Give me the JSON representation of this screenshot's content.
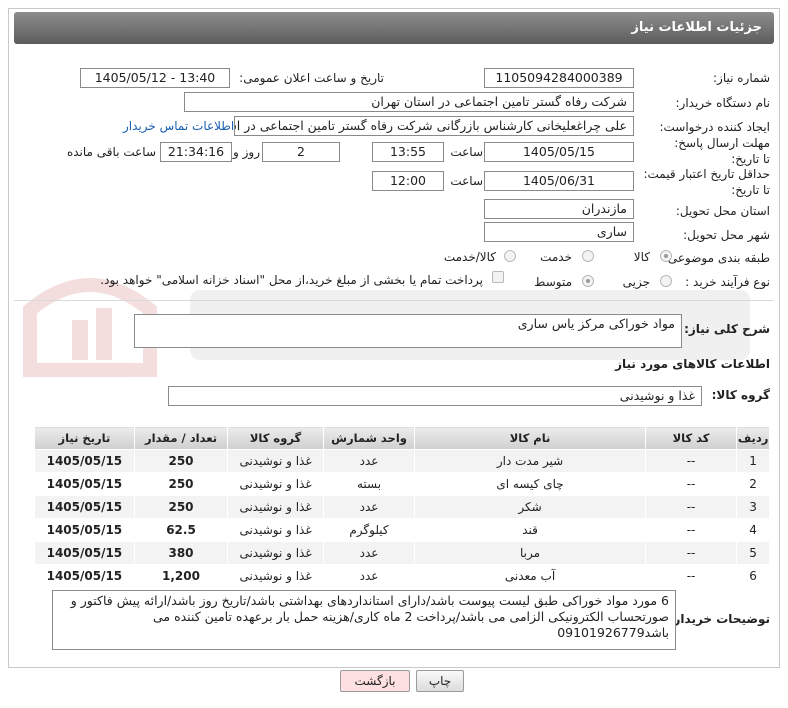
{
  "header": {
    "title": "جزئیات اطلاعات نیاز"
  },
  "fields": {
    "need_number_label": "شماره نیاز:",
    "need_number": "1105094284000389",
    "announce_label": "تاریخ و ساعت اعلان عمومی:",
    "announce_value": "1405/05/12 - 13:40",
    "buyer_org_label": "نام دستگاه خریدار:",
    "buyer_org": "شرکت رفاه گستر تامین اجتماعی در استان تهران",
    "creator_label": "ایجاد کننده درخواست:",
    "creator": "علی چراغعلیخانی کارشناس بازرگانی شرکت رفاه گستر تامین اجتماعی در استا",
    "contact_link": "اطلاعات تماس خریدار",
    "deadline_label": "مهلت ارسال پاسخ: تا تاریخ:",
    "deadline_date": "1405/05/15",
    "time_label": "ساعت",
    "deadline_time": "13:55",
    "days_value": "2",
    "days_label": "روز و",
    "remaining_time": "21:34:16",
    "remaining_label": "ساعت باقی مانده",
    "price_validity_label": "حداقل تاریخ اعتبار قیمت: تا تاریخ:",
    "price_validity_date": "1405/06/31",
    "price_validity_time": "12:00",
    "province_label": "استان محل تحویل:",
    "province": "مازندران",
    "city_label": "شهر محل تحویل:",
    "city": "ساری",
    "category_label": "طبقه بندی موضوعی:",
    "category_options": [
      "کالا",
      "خدمت",
      "کالا/خدمت"
    ],
    "purchase_type_label": "نوع فرآیند خرید :",
    "purchase_options": [
      "جزیی",
      "متوسط"
    ],
    "payment_note": "پرداخت تمام یا بخشی از مبلغ خرید،از محل \"اسناد خزانه اسلامی\" خواهد بود."
  },
  "description": {
    "label": "شرح کلی نیاز:",
    "value": "مواد خوراکی مرکز یاس ساری"
  },
  "goods_section": {
    "title": "اطلاعات کالاهای مورد نیاز",
    "group_label": "گروه کالا:",
    "group_value": "غذا و نوشیدنی"
  },
  "table": {
    "headers": [
      "ردیف",
      "کد کالا",
      "نام کالا",
      "واحد شمارش",
      "گروه کالا",
      "تعداد / مقدار",
      "تاریخ نیاز"
    ],
    "rows": [
      [
        "1",
        "--",
        "شیر مدت دار",
        "عدد",
        "غذا و نوشیدنی",
        "250",
        "1405/05/15"
      ],
      [
        "2",
        "--",
        "چای کیسه ای",
        "بسته",
        "غذا و نوشیدنی",
        "250",
        "1405/05/15"
      ],
      [
        "3",
        "--",
        "شکر",
        "عدد",
        "غذا و نوشیدنی",
        "250",
        "1405/05/15"
      ],
      [
        "4",
        "--",
        "قند",
        "کیلوگرم",
        "غذا و نوشیدنی",
        "62.5",
        "1405/05/15"
      ],
      [
        "5",
        "--",
        "مربا",
        "عدد",
        "غذا و نوشیدنی",
        "380",
        "1405/05/15"
      ],
      [
        "6",
        "--",
        "آب معدنی",
        "عدد",
        "غذا و نوشیدنی",
        "1,200",
        "1405/05/15"
      ]
    ]
  },
  "notes": {
    "label": "توضیحات خریدار:",
    "value": "6 مورد مواد خوراکی طبق لیست پیوست باشد/دارای استانداردهای بهداشتی باشد/تاریخ روز باشد/ارائه پیش فاکتور و صورتحساب الکترونیکی الزامی می باشد/پرداخت 2 ماه کاری/هزینه حمل بار برعهده تامین کننده می باشد09101926779"
  },
  "buttons": {
    "print": "چاپ",
    "back": "بازگشت"
  },
  "colors": {
    "title_bg": "#6e6e6e",
    "link": "#1a5fb4",
    "back_btn_bg": "#fde0e0"
  }
}
